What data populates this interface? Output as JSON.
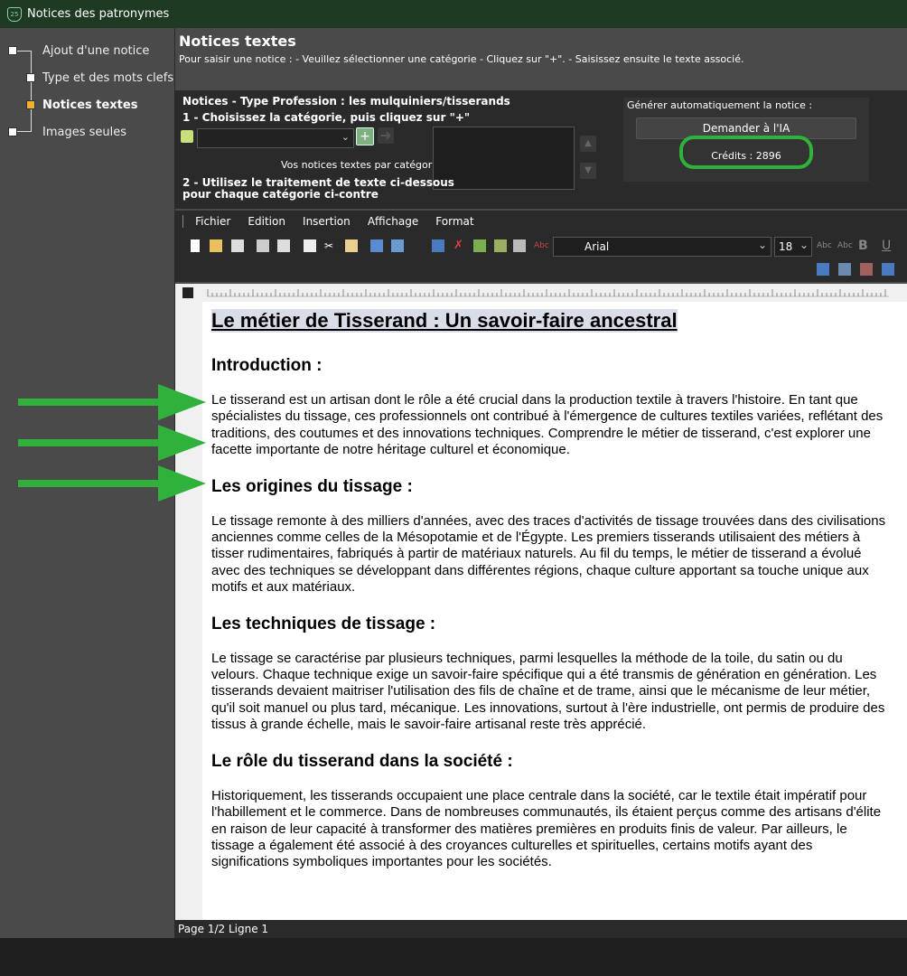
{
  "window": {
    "title": "Notices des patronymes"
  },
  "sidebar": {
    "items": [
      {
        "label": "Ajout d'une notice"
      },
      {
        "label": "Type et des mots clefs"
      },
      {
        "label": "Notices textes"
      },
      {
        "label": "Images seules"
      }
    ]
  },
  "main": {
    "title": "Notices textes",
    "subtitle": "Pour saisir une notice : - Veuillez sélectionner une catégorie - Cliquez sur \"+\". - Saisissez ensuite le texte associé."
  },
  "panel": {
    "notices_type": "Notices - Type Profession : les mulquiniers/tisserands",
    "step1": "1 - Choisissez la catégorie, puis cliquez sur \"+\"",
    "by_category": "Vos notices textes par catégorie :",
    "step2_line1": "2 - Utilisez le traitement de texte ci-dessous",
    "step2_line2": "pour chaque catégorie ci-contre",
    "generate_label": "Générer automatiquement la notice :",
    "ia_button": "Demander à l'IA",
    "credits": "Crédits : 2896"
  },
  "menu": {
    "items": [
      "Fichier",
      "Edition",
      "Insertion",
      "Affichage",
      "Format"
    ]
  },
  "toolbar": {
    "font": "Arial",
    "size": "18"
  },
  "document": {
    "title": "Le métier de Tisserand : Un savoir-faire ancestral",
    "h_intro": "Introduction :",
    "p_intro": "Le tisserand est un artisan dont le rôle a été crucial dans la production textile à travers l'histoire. En tant que spécialistes du tissage, ces professionnels ont contribué à l'émergence de cultures textiles variées, reflétant des traditions, des coutumes et des innovations techniques. Comprendre le métier de tisserand, c'est explorer une facette importante de notre héritage culturel et économique.",
    "h_origins": "Les origines du tissage :",
    "p_origins": "Le tissage remonte à des milliers d'années, avec des traces d'activités de tissage trouvées dans des civilisations anciennes comme celles de la Mésopotamie et de l'Égypte. Les premiers tisserands utilisaient des métiers à tisser rudimentaires, fabriqués à partir de matériaux naturels. Au fil du temps, le métier de tisserand a évolué avec des techniques se développant dans différentes régions, chaque culture apportant sa touche unique aux motifs et aux matériaux.",
    "h_techniques": "Les techniques de tissage :",
    "p_techniques": "Le tissage se caractérise par plusieurs techniques, parmi lesquelles la méthode de la toile, du satin ou du velours. Chaque technique exige un savoir-faire spécifique qui a été transmis de génération en génération. Les tisserands devaient maitriser l'utilisation des fils de chaîne et de trame, ainsi que le mécanisme de leur métier, qu'il soit manuel ou plus tard, mécanique. Les innovations, surtout à l'ère industrielle, ont permis de produire des tissus à grande échelle, mais le savoir-faire artisanal reste très apprécié.",
    "h_role": "Le rôle du tisserand dans la société :",
    "p_role": "Historiquement, les tisserands occupaient une place centrale dans la société, car le textile était impératif pour l'habillement et le commerce. Dans de nombreuses communautés, ils étaient perçus comme des artisans d'élite en raison de leur capacité à transformer des matières premières en produits finis de valeur. Par ailleurs, le tissage a également été associé à des croyances culturelles et spirituelles, certains motifs ayant des significations symboliques importantes pour les sociétés."
  },
  "status": {
    "text": "Page 1/2 Ligne 1"
  },
  "colors": {
    "highlight": "#2fb13c",
    "active_nav": "#f0b030"
  }
}
